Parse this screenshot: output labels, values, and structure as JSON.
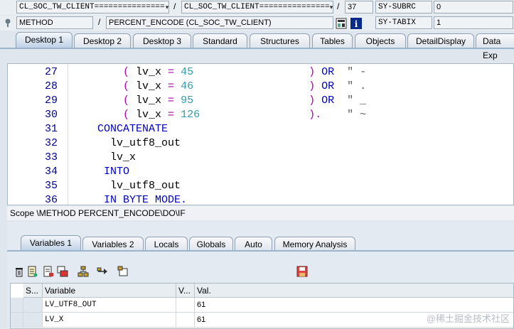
{
  "info": {
    "row1": {
      "field1": "CL_SOC_TW_CLIENT===============",
      "field2": "CL_SOC_TW_CLIENT===============",
      "line_no": "37",
      "sysfield": "SY-SUBRC",
      "sysvalue": "0"
    },
    "row2": {
      "type": "METHOD",
      "name": "PERCENT_ENCODE (CL_SOC_TW_CLIENT)",
      "sysfield": "SY-TABIX",
      "sysvalue": "1"
    },
    "slash": "/"
  },
  "desktop_tabs": [
    "Desktop 1",
    "Desktop 2",
    "Desktop 3",
    "Standard",
    "Structures",
    "Tables",
    "Objects",
    "DetailDisplay",
    "Data Exp"
  ],
  "code_lines": [
    {
      "no": "27",
      "parts": [
        [
          "par",
          "( "
        ],
        [
          "var",
          "lv_x "
        ],
        [
          "par",
          "= "
        ],
        [
          "num",
          "45"
        ],
        [
          "var",
          "                  "
        ],
        [
          "par",
          ") "
        ],
        [
          "kw",
          "OR  "
        ],
        [
          "cmt",
          "\" -"
        ]
      ]
    },
    {
      "no": "28",
      "parts": [
        [
          "par",
          "( "
        ],
        [
          "var",
          "lv_x "
        ],
        [
          "par",
          "= "
        ],
        [
          "num",
          "46"
        ],
        [
          "var",
          "                  "
        ],
        [
          "par",
          ") "
        ],
        [
          "kw",
          "OR  "
        ],
        [
          "cmt",
          "\" ."
        ]
      ]
    },
    {
      "no": "29",
      "parts": [
        [
          "par",
          "( "
        ],
        [
          "var",
          "lv_x "
        ],
        [
          "par",
          "= "
        ],
        [
          "num",
          "95"
        ],
        [
          "var",
          "                  "
        ],
        [
          "par",
          ") "
        ],
        [
          "kw",
          "OR  "
        ],
        [
          "cmt",
          "\" _"
        ]
      ]
    },
    {
      "no": "30",
      "parts": [
        [
          "par",
          "( "
        ],
        [
          "var",
          "lv_x "
        ],
        [
          "par",
          "= "
        ],
        [
          "num",
          "126"
        ],
        [
          "var",
          "                 "
        ],
        [
          "par",
          ")."
        ],
        [
          "var",
          "    "
        ],
        [
          "cmt",
          "\" ~"
        ]
      ]
    },
    {
      "no": "31",
      "parts": [
        [
          "kw",
          "CONCATENATE"
        ]
      ]
    },
    {
      "no": "32",
      "parts": [
        [
          "var",
          "lv_utf8_out"
        ]
      ]
    },
    {
      "no": "33",
      "parts": [
        [
          "var",
          "lv_x"
        ]
      ]
    },
    {
      "no": "34",
      "parts": [
        [
          "kw",
          "INTO"
        ]
      ]
    },
    {
      "no": "35",
      "parts": [
        [
          "var",
          "lv_utf8_out"
        ]
      ]
    },
    {
      "no": "36",
      "parts": [
        [
          "kw",
          "IN BYTE MODE."
        ]
      ]
    }
  ],
  "scope": "Scope \\METHOD PERCENT_ENCODE\\DO\\IF",
  "var_tabs": [
    "Variables 1",
    "Variables 2",
    "Locals",
    "Globals",
    "Auto",
    "Memory Analysis"
  ],
  "table": {
    "headers": [
      "S...",
      "Variable",
      "V...",
      "Val."
    ],
    "rows": [
      {
        "variable": "LV_UTF8_OUT",
        "value": "61"
      },
      {
        "variable": "LV_X",
        "value": "61"
      }
    ]
  },
  "watermark": "@稀土掘金技术社区",
  "colors": {
    "keyword": "#0000c0",
    "number": "#3399aa",
    "operator": "#b000b0"
  }
}
